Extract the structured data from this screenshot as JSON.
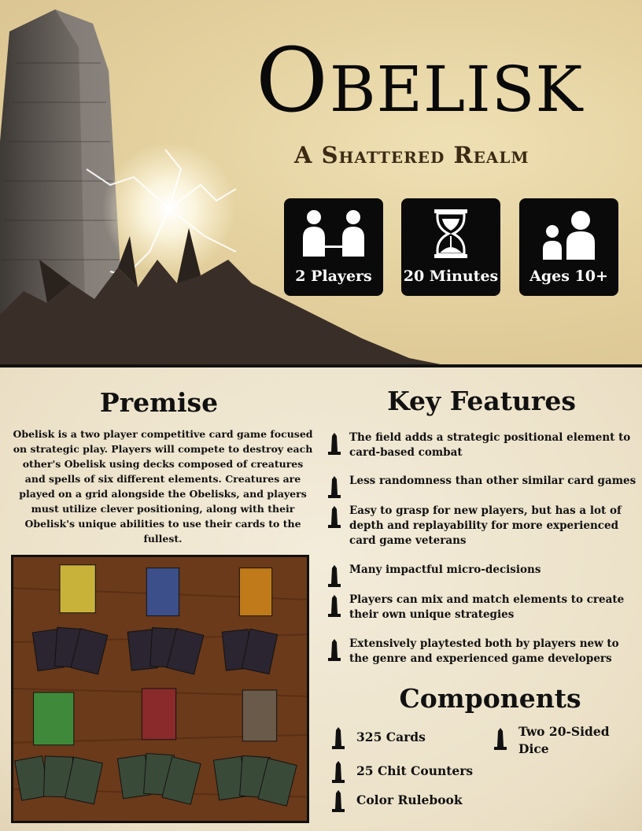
{
  "header": {
    "title_initial": "O",
    "title_mid": "BEL",
    "title_i": "I",
    "title_end": "SK",
    "subtitle": "A Shattered Realm"
  },
  "badges": [
    {
      "label": "2 Players",
      "icon": "two-players-icon"
    },
    {
      "label": "20 Minutes",
      "icon": "hourglass-icon"
    },
    {
      "label": "Ages 10+",
      "icon": "ages-icon"
    }
  ],
  "premise": {
    "heading": "Premise",
    "text": "Obelisk is a two player competitive card game focused on strategic play. Players will compete to destroy each other's Obelisk using decks composed of creatures and spells of six different elements. Creatures are played on a grid alongside the Obelisks, and players must utilize clever positioning, along with their Obelisk's unique abilities to use their cards to the fullest."
  },
  "features": {
    "heading": "Key Features",
    "items": [
      "The field adds a strategic positional element to card-based combat",
      "Less randomness than other similar card games",
      "Easy to grasp for new players, but has a lot of depth and replayability for more experienced card game veterans",
      "Many impactful micro-decisions",
      "Players can mix and match elements to create their own unique strategies",
      "Extensively playtested both by players new to the genre and experienced game developers"
    ]
  },
  "components": {
    "heading": "Components",
    "items": [
      "325 Cards",
      "25 Chit Counters",
      "Color Rulebook",
      "Two 20-Sided Dice"
    ]
  },
  "colors": {
    "badge_bg": "#0a0a0a",
    "subtitle": "#3c2a14",
    "table_wood": "#6b3a1a"
  }
}
